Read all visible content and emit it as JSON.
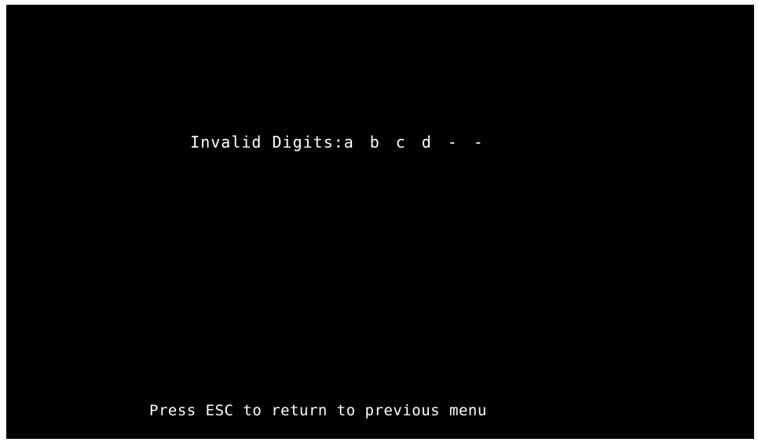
{
  "screen": {
    "label": "Invalid Digits:",
    "digits": [
      "a",
      "b",
      "c",
      "d",
      "-",
      "-"
    ],
    "footer": "Press ESC to return to previous menu"
  },
  "colors": {
    "background": "#000000",
    "text": "#ffffff"
  }
}
